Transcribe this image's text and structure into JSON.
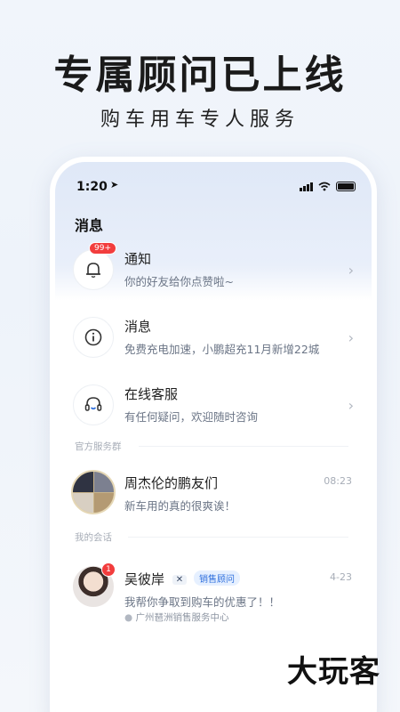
{
  "promo": {
    "headline": "专属顾问已上线",
    "subline": "购车用车专人服务"
  },
  "status_bar": {
    "time": "1:20"
  },
  "page": {
    "title": "消息"
  },
  "rows": [
    {
      "title": "通知",
      "subtitle": "你的好友给你点赞啦~",
      "badge": "99+",
      "icon": "bell-icon"
    },
    {
      "title": "消息",
      "subtitle": "免费充电加速，小鹏超充11月新增22城",
      "icon": "info-icon"
    },
    {
      "title": "在线客服",
      "subtitle": "有任何疑问，欢迎随时咨询",
      "icon": "headset-icon"
    }
  ],
  "sections": {
    "official_group": "官方服务群",
    "my_chats": "我的会话"
  },
  "group_chat": {
    "name": "周杰伦的鹏友们",
    "message": "新车用的真的很爽诶！",
    "time": "08:23"
  },
  "advisor_chat": {
    "name": "吴彼岸",
    "brand_tag": "✕",
    "role_tag": "销售顾问",
    "message": "我帮你争取到购车的优惠了！！",
    "location": "广州琶洲销售服务中心",
    "time": "4-23",
    "unread": "1"
  },
  "watermark": "大玩客",
  "colors": {
    "accent": "#2f6fdd",
    "badge": "#f23d3d"
  }
}
